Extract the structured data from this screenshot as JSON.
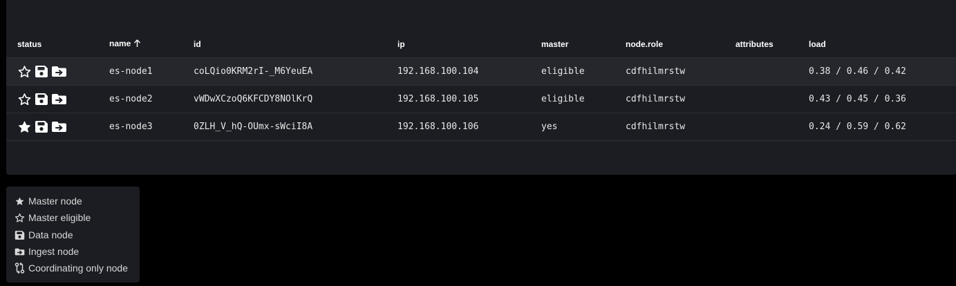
{
  "table": {
    "columns": {
      "status": "status",
      "name": "name",
      "id": "id",
      "ip": "ip",
      "master": "master",
      "node_role": "node.role",
      "attributes": "attributes",
      "load": "load"
    },
    "sort": {
      "column": "name",
      "direction": "ascending",
      "icon": "arrow-up-icon"
    },
    "rows": [
      {
        "is_master": false,
        "name": "es-node1",
        "id": "coLQio0KRM2rI-_M6YeuEA",
        "ip": "192.168.100.104",
        "master": "eligible",
        "node_role": "cdfhilmrstw",
        "attributes": "",
        "load": "0.38 / 0.46 / 0.42"
      },
      {
        "is_master": false,
        "name": "es-node2",
        "id": "vWDwXCzoQ6KFCDY8NOlKrQ",
        "ip": "192.168.100.105",
        "master": "eligible",
        "node_role": "cdfhilmrstw",
        "attributes": "",
        "load": "0.43 / 0.45 / 0.36"
      },
      {
        "is_master": true,
        "name": "es-node3",
        "id": "0ZLH_V_hQ-OUmx-sWciI8A",
        "ip": "192.168.100.106",
        "master": "yes",
        "node_role": "cdfhilmrstw",
        "attributes": "",
        "load": "0.24 / 0.59 / 0.62"
      }
    ]
  },
  "legend": {
    "items": [
      {
        "icon": "star-filled-icon",
        "label": "Master node"
      },
      {
        "icon": "star-outline-icon",
        "label": "Master eligible"
      },
      {
        "icon": "data-node-icon",
        "label": "Data node"
      },
      {
        "icon": "ingest-node-icon",
        "label": "Ingest node"
      },
      {
        "icon": "coordinating-node-icon",
        "label": "Coordinating only node"
      }
    ]
  },
  "colors": {
    "background": "#000000",
    "panel": "#1b1d22",
    "row_highlight": "#25272d",
    "text": "#e6e6e6"
  }
}
